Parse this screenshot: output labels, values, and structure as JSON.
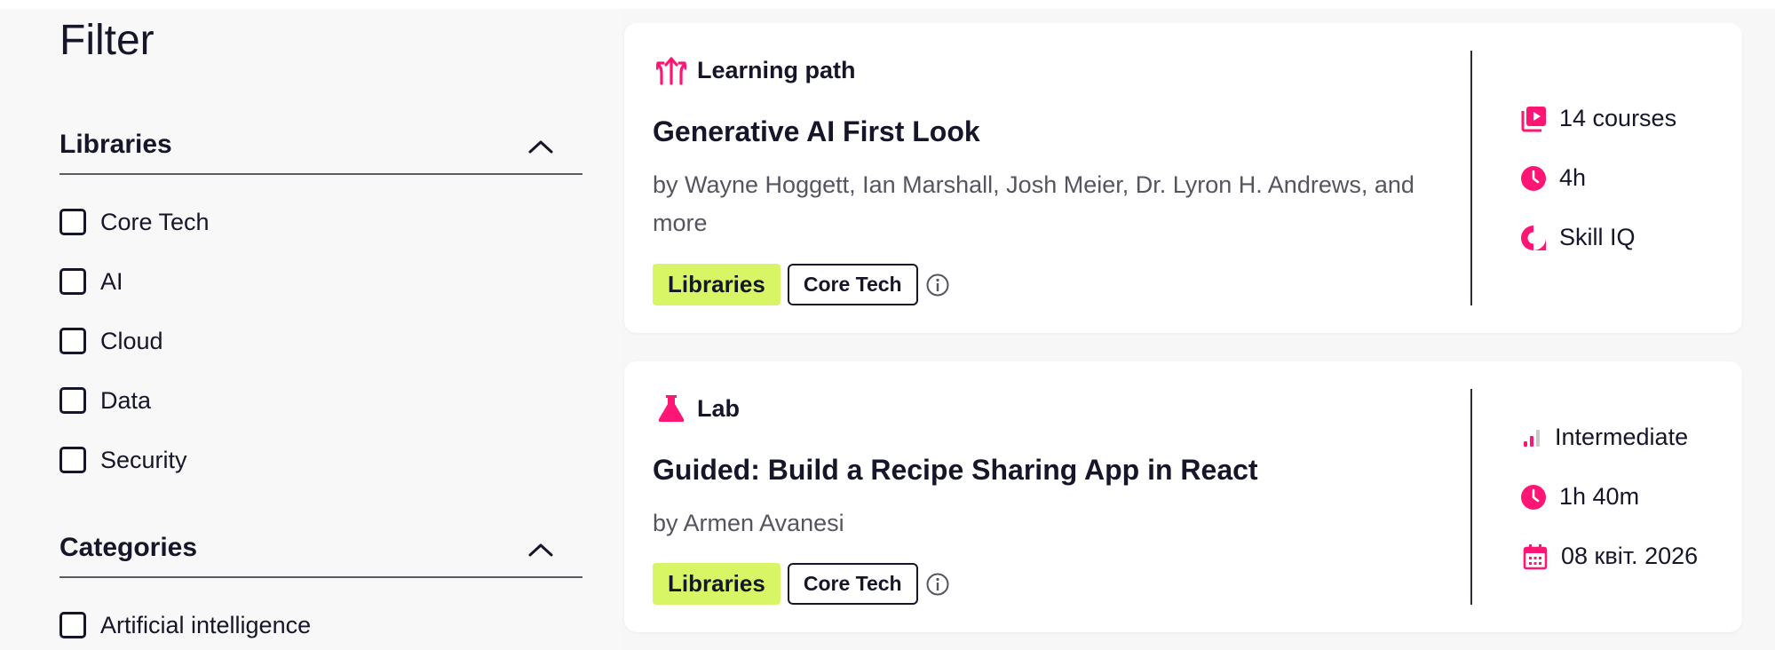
{
  "filter": {
    "title": "Filter",
    "sections": [
      {
        "label": "Libraries",
        "options": [
          "Core Tech",
          "AI",
          "Cloud",
          "Data",
          "Security"
        ]
      },
      {
        "label": "Categories",
        "options": [
          "Artificial intelligence"
        ]
      }
    ]
  },
  "results": [
    {
      "type_label": "Learning path",
      "title": "Generative AI First Look",
      "authors": "by Wayne Hoggett, Ian Marshall, Josh Meier, Dr. Lyron H. Andrews, and more",
      "tags": [
        "Libraries",
        "Core Tech"
      ],
      "meta": {
        "courses": "14 courses",
        "duration": "4h",
        "extra": "Skill IQ"
      }
    },
    {
      "type_label": "Lab",
      "title": "Guided: Build a Recipe Sharing App in React",
      "authors": "by Armen Avanesi",
      "tags": [
        "Libraries",
        "Core Tech"
      ],
      "meta": {
        "level": "Intermediate",
        "duration": "1h 40m",
        "date": "08 квіт. 2026"
      }
    }
  ],
  "colors": {
    "accent_pink": "#ff1675",
    "tag_lime": "#d8f566",
    "text_dark": "#16162a"
  },
  "icons": [
    "learning-path-icon",
    "lab-flask-icon",
    "courses-icon",
    "clock-icon",
    "skill-iq-icon",
    "level-bars-icon",
    "calendar-icon",
    "info-icon",
    "chevron-up-icon"
  ]
}
